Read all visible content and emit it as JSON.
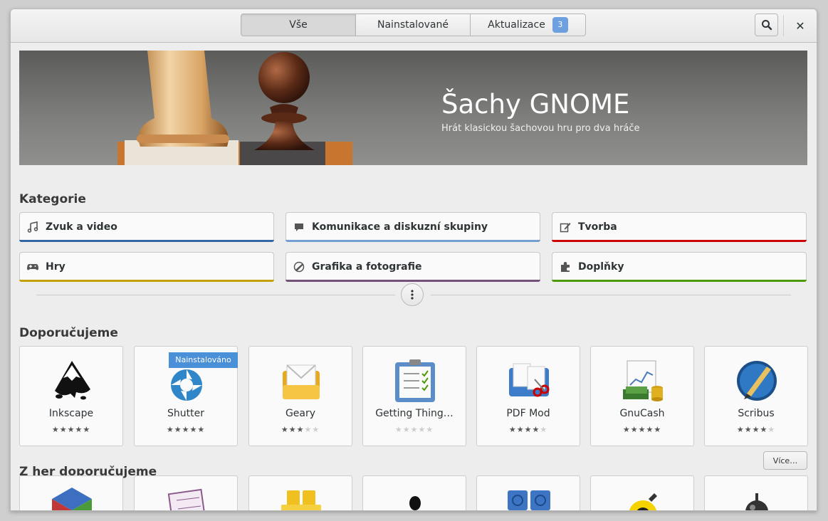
{
  "header": {
    "tabs": [
      {
        "label": "Vše",
        "active": true
      },
      {
        "label": "Nainstalované",
        "active": false
      },
      {
        "label": "Aktualizace",
        "active": false,
        "badge": "3"
      }
    ],
    "search_icon": "search-icon",
    "close_icon": "close-icon",
    "close_label": "✕"
  },
  "banner": {
    "title": "Šachy GNOME",
    "subtitle": "Hrát klasickou šachovou hru pro dva hráče"
  },
  "categories": {
    "title": "Kategorie",
    "items": [
      {
        "label": "Zvuk a video",
        "icon": "music-note-icon",
        "color": "#3465a4"
      },
      {
        "label": "Komunikace a diskuzní skupiny",
        "icon": "chat-bubble-icon",
        "color": "#729fcf"
      },
      {
        "label": "Tvorba",
        "icon": "edit-icon",
        "color": "#cc0000"
      },
      {
        "label": "Hry",
        "icon": "gamepad-icon",
        "color": "#c4a000"
      },
      {
        "label": "Grafika a fotografie",
        "icon": "graphics-icon",
        "color": "#75507b"
      },
      {
        "label": "Doplňky",
        "icon": "puzzle-icon",
        "color": "#4e9a06"
      }
    ]
  },
  "recommended": {
    "title": "Doporučujeme",
    "apps": [
      {
        "name": "Inkscape",
        "rating": 5,
        "installed": false
      },
      {
        "name": "Shutter",
        "rating": 5,
        "installed": true,
        "installed_label": "Nainstalováno"
      },
      {
        "name": "Geary",
        "rating": 3,
        "installed": false
      },
      {
        "name": "Getting Thing…",
        "rating": 0,
        "installed": false
      },
      {
        "name": "PDF Mod",
        "rating": 4,
        "installed": false
      },
      {
        "name": "GnuCash",
        "rating": 5,
        "installed": false
      },
      {
        "name": "Scribus",
        "rating": 4,
        "installed": false
      }
    ]
  },
  "games": {
    "title": "Z her doporučujeme",
    "more_label": "Více…",
    "tiles": [
      "sudoku-cube-icon",
      "sudoku-icon",
      "tiles-icon",
      "tux-racer-icon",
      "blocks-icon",
      "swell-foop-icon",
      "mines-icon"
    ]
  }
}
